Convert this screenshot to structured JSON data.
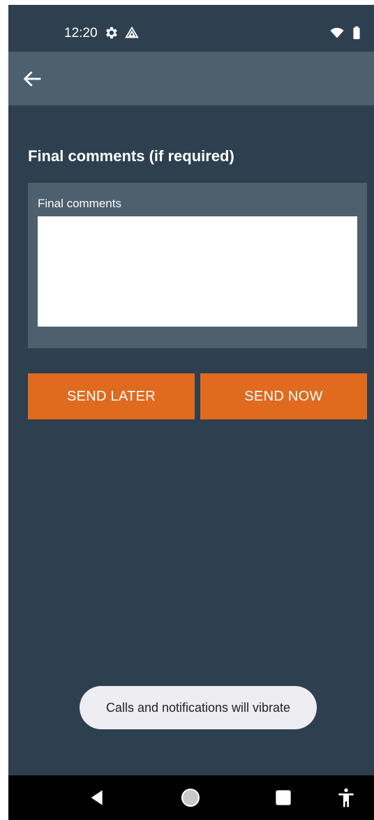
{
  "status_bar": {
    "time": "12:20",
    "icons": [
      "settings-gear-icon",
      "drive-icon",
      "wifi-icon",
      "battery-icon"
    ]
  },
  "toolbar": {
    "back_icon": "arrow-left-icon"
  },
  "form": {
    "section_title": "Final comments (if required)",
    "comments_label": "Final comments",
    "comments_value": "",
    "send_later_label": "SEND LATER",
    "send_now_label": "SEND NOW"
  },
  "toast": {
    "message": "Calls and notifications will vibrate"
  },
  "nav_bar": {
    "icons": [
      "back-triangle-icon",
      "home-circle-icon",
      "recents-square-icon",
      "accessibility-icon"
    ]
  },
  "colors": {
    "background": "#2e3f50",
    "toolbar": "#4e5f6d",
    "accent": "#e06a1e",
    "toast_bg": "#eeeef2"
  }
}
